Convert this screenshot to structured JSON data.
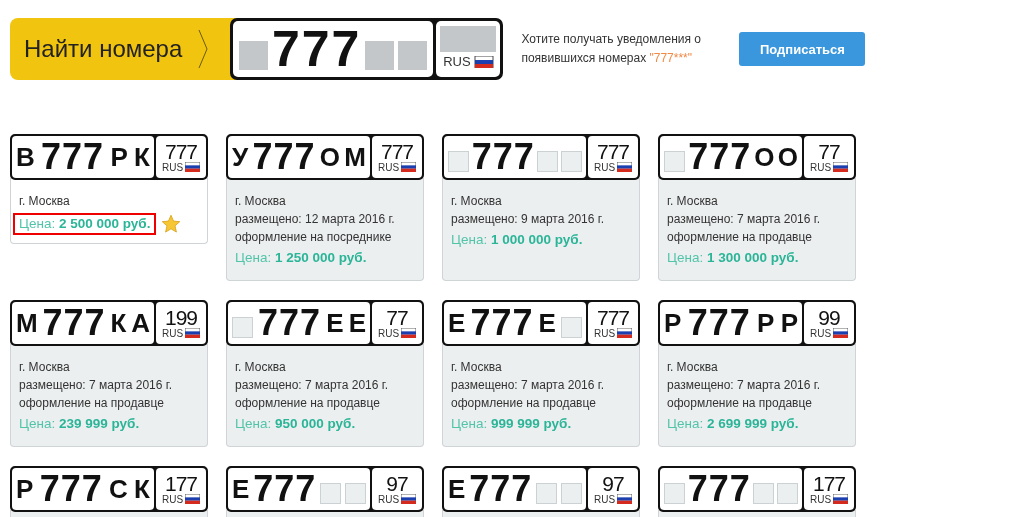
{
  "search": {
    "label": "Найти номера",
    "plate": {
      "slots": [
        {
          "kind": "blank"
        },
        {
          "kind": "digits",
          "text": "777"
        },
        {
          "kind": "blank"
        },
        {
          "kind": "blank"
        }
      ],
      "country": "RUS"
    }
  },
  "notice": {
    "text": "Хотите получать уведомления о появившихся номерах",
    "pattern": "\"777***\""
  },
  "subscribe_button": "Подписаться",
  "cards": [
    {
      "featured": true,
      "plate": {
        "slots": [
          {
            "kind": "letter",
            "text": "В"
          },
          {
            "kind": "digits",
            "text": "777"
          },
          {
            "kind": "letter",
            "text": "Р"
          },
          {
            "kind": "letter",
            "text": "К"
          }
        ],
        "region": "777",
        "country": "RUS"
      },
      "lines": [
        "г. Москва"
      ],
      "price_label": "Цена:",
      "price_value": "2 500 000 руб."
    },
    {
      "featured": false,
      "plate": {
        "slots": [
          {
            "kind": "letter",
            "text": "У"
          },
          {
            "kind": "digits",
            "text": "777"
          },
          {
            "kind": "letter",
            "text": "О"
          },
          {
            "kind": "letter",
            "text": "М"
          }
        ],
        "region": "777",
        "country": "RUS"
      },
      "lines": [
        "г. Москва",
        "размещено: 12 марта 2016 г.",
        "оформление на посреднике"
      ],
      "price_label": "Цена:",
      "price_value": "1 250 000 руб."
    },
    {
      "featured": false,
      "plate": {
        "slots": [
          {
            "kind": "blank"
          },
          {
            "kind": "digits",
            "text": "777"
          },
          {
            "kind": "blank"
          },
          {
            "kind": "blank"
          }
        ],
        "region": "777",
        "country": "RUS"
      },
      "lines": [
        "г. Москва",
        "размещено: 9 марта 2016 г."
      ],
      "price_label": "Цена:",
      "price_value": "1 000 000 руб."
    },
    {
      "featured": false,
      "plate": {
        "slots": [
          {
            "kind": "blank"
          },
          {
            "kind": "digits",
            "text": "777"
          },
          {
            "kind": "letter",
            "text": "О"
          },
          {
            "kind": "letter",
            "text": "О"
          }
        ],
        "region": "77",
        "country": "RUS"
      },
      "lines": [
        "г. Москва",
        "размещено: 7 марта 2016 г.",
        "оформление на продавце"
      ],
      "price_label": "Цена:",
      "price_value": "1 300 000 руб."
    },
    {
      "featured": false,
      "plate": {
        "slots": [
          {
            "kind": "letter",
            "text": "М"
          },
          {
            "kind": "digits",
            "text": "777"
          },
          {
            "kind": "letter",
            "text": "К"
          },
          {
            "kind": "letter",
            "text": "А"
          }
        ],
        "region": "199",
        "country": "RUS"
      },
      "lines": [
        "г. Москва",
        "размещено: 7 марта 2016 г.",
        "оформление на продавце"
      ],
      "price_label": "Цена:",
      "price_value": "239 999 руб."
    },
    {
      "featured": false,
      "plate": {
        "slots": [
          {
            "kind": "blank"
          },
          {
            "kind": "digits",
            "text": "777"
          },
          {
            "kind": "letter",
            "text": "Е"
          },
          {
            "kind": "letter",
            "text": "Е"
          }
        ],
        "region": "77",
        "country": "RUS"
      },
      "lines": [
        "г. Москва",
        "размещено: 7 марта 2016 г.",
        "оформление на продавце"
      ],
      "price_label": "Цена:",
      "price_value": "950 000 руб."
    },
    {
      "featured": false,
      "plate": {
        "slots": [
          {
            "kind": "letter",
            "text": "Е"
          },
          {
            "kind": "digits",
            "text": "777"
          },
          {
            "kind": "letter",
            "text": "Е"
          },
          {
            "kind": "blank"
          }
        ],
        "region": "777",
        "country": "RUS"
      },
      "lines": [
        "г. Москва",
        "размещено: 7 марта 2016 г.",
        "оформление на продавце"
      ],
      "price_label": "Цена:",
      "price_value": "999 999 руб."
    },
    {
      "featured": false,
      "plate": {
        "slots": [
          {
            "kind": "letter",
            "text": "Р"
          },
          {
            "kind": "digits",
            "text": "777"
          },
          {
            "kind": "letter",
            "text": "Р"
          },
          {
            "kind": "letter",
            "text": "Р"
          }
        ],
        "region": "99",
        "country": "RUS"
      },
      "lines": [
        "г. Москва",
        "размещено: 7 марта 2016 г.",
        "оформление на продавце"
      ],
      "price_label": "Цена:",
      "price_value": "2 699 999 руб."
    },
    {
      "featured": false,
      "plate": {
        "slots": [
          {
            "kind": "letter",
            "text": "Р"
          },
          {
            "kind": "digits",
            "text": "777"
          },
          {
            "kind": "letter",
            "text": "С"
          },
          {
            "kind": "letter",
            "text": "К"
          }
        ],
        "region": "177",
        "country": "RUS"
      }
    },
    {
      "featured": false,
      "plate": {
        "slots": [
          {
            "kind": "letter",
            "text": "Е"
          },
          {
            "kind": "digits",
            "text": "777"
          },
          {
            "kind": "blank"
          },
          {
            "kind": "blank"
          }
        ],
        "region": "97",
        "country": "RUS"
      }
    },
    {
      "featured": false,
      "plate": {
        "slots": [
          {
            "kind": "letter",
            "text": "Е"
          },
          {
            "kind": "digits",
            "text": "777"
          },
          {
            "kind": "blank"
          },
          {
            "kind": "blank"
          }
        ],
        "region": "97",
        "country": "RUS"
      }
    },
    {
      "featured": false,
      "plate": {
        "slots": [
          {
            "kind": "blank"
          },
          {
            "kind": "digits",
            "text": "777"
          },
          {
            "kind": "blank"
          },
          {
            "kind": "blank"
          }
        ],
        "region": "177",
        "country": "RUS"
      }
    }
  ]
}
